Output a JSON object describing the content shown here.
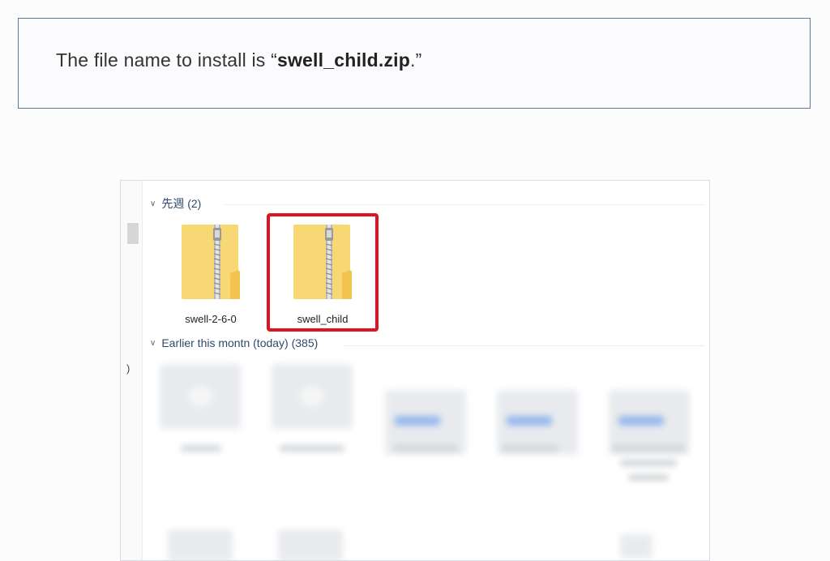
{
  "note": {
    "prefix": "The file name to install is “",
    "filename": "swell_child.zip",
    "suffix": ".”"
  },
  "explorer": {
    "left_marker": ")",
    "group_last_week": {
      "label": "先週 (2)"
    },
    "group_earlier": {
      "label": "Earlier this montn (today) (385)"
    },
    "files": [
      {
        "name": "swell-2-6-0",
        "icon": "zip-folder-icon"
      },
      {
        "name": "swell_child",
        "icon": "zip-folder-icon",
        "highlighted": true
      }
    ],
    "colors": {
      "highlight": "#e0141e",
      "folder": "#f8d775",
      "header_text": "#2e4a6b"
    }
  }
}
